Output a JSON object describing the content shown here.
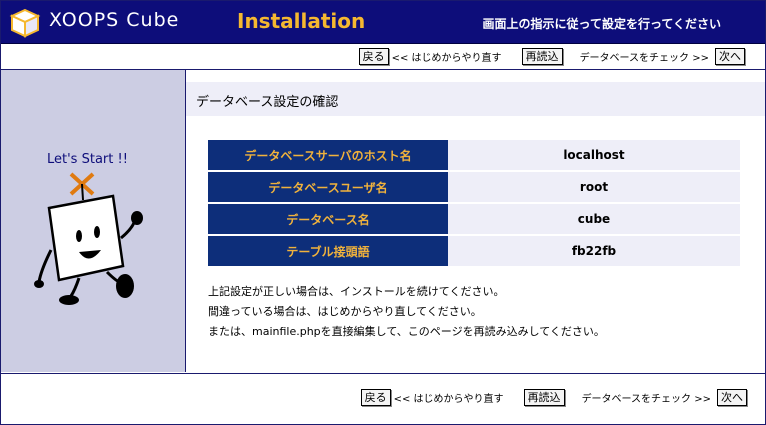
{
  "header": {
    "logo": "XOOPS Cube",
    "title": "Installation",
    "instruction": "画面上の指示に従って設定を行ってください"
  },
  "nav": {
    "back_label": "戻る",
    "back_text": "<< はじめからやり直す",
    "reload_label": "再読込",
    "next_text": "データベースをチェック >>",
    "next_label": "次へ"
  },
  "sidebar": {
    "greeting": "Let's Start !!"
  },
  "main": {
    "section_title": "データベース設定の確認",
    "settings": [
      {
        "label": "データベースサーバのホスト名",
        "value": "localhost"
      },
      {
        "label": "データベースユーザ名",
        "value": "root"
      },
      {
        "label": "データベース名",
        "value": "cube"
      },
      {
        "label": "テーブル接頭語",
        "value": "fb22fb"
      }
    ],
    "messages": [
      "上記設定が正しい場合は、インストールを続けてください。",
      "間違っている場合は、はじめからやり直してください。",
      "または、mainfile.phpを直接編集して、このページを再読み込みしてください。"
    ]
  },
  "colors": {
    "header_bg": "#0d0d7a",
    "accent": "#f5b830",
    "label_bg": "#0d2e7a",
    "sidebar_bg": "#cccde3"
  }
}
